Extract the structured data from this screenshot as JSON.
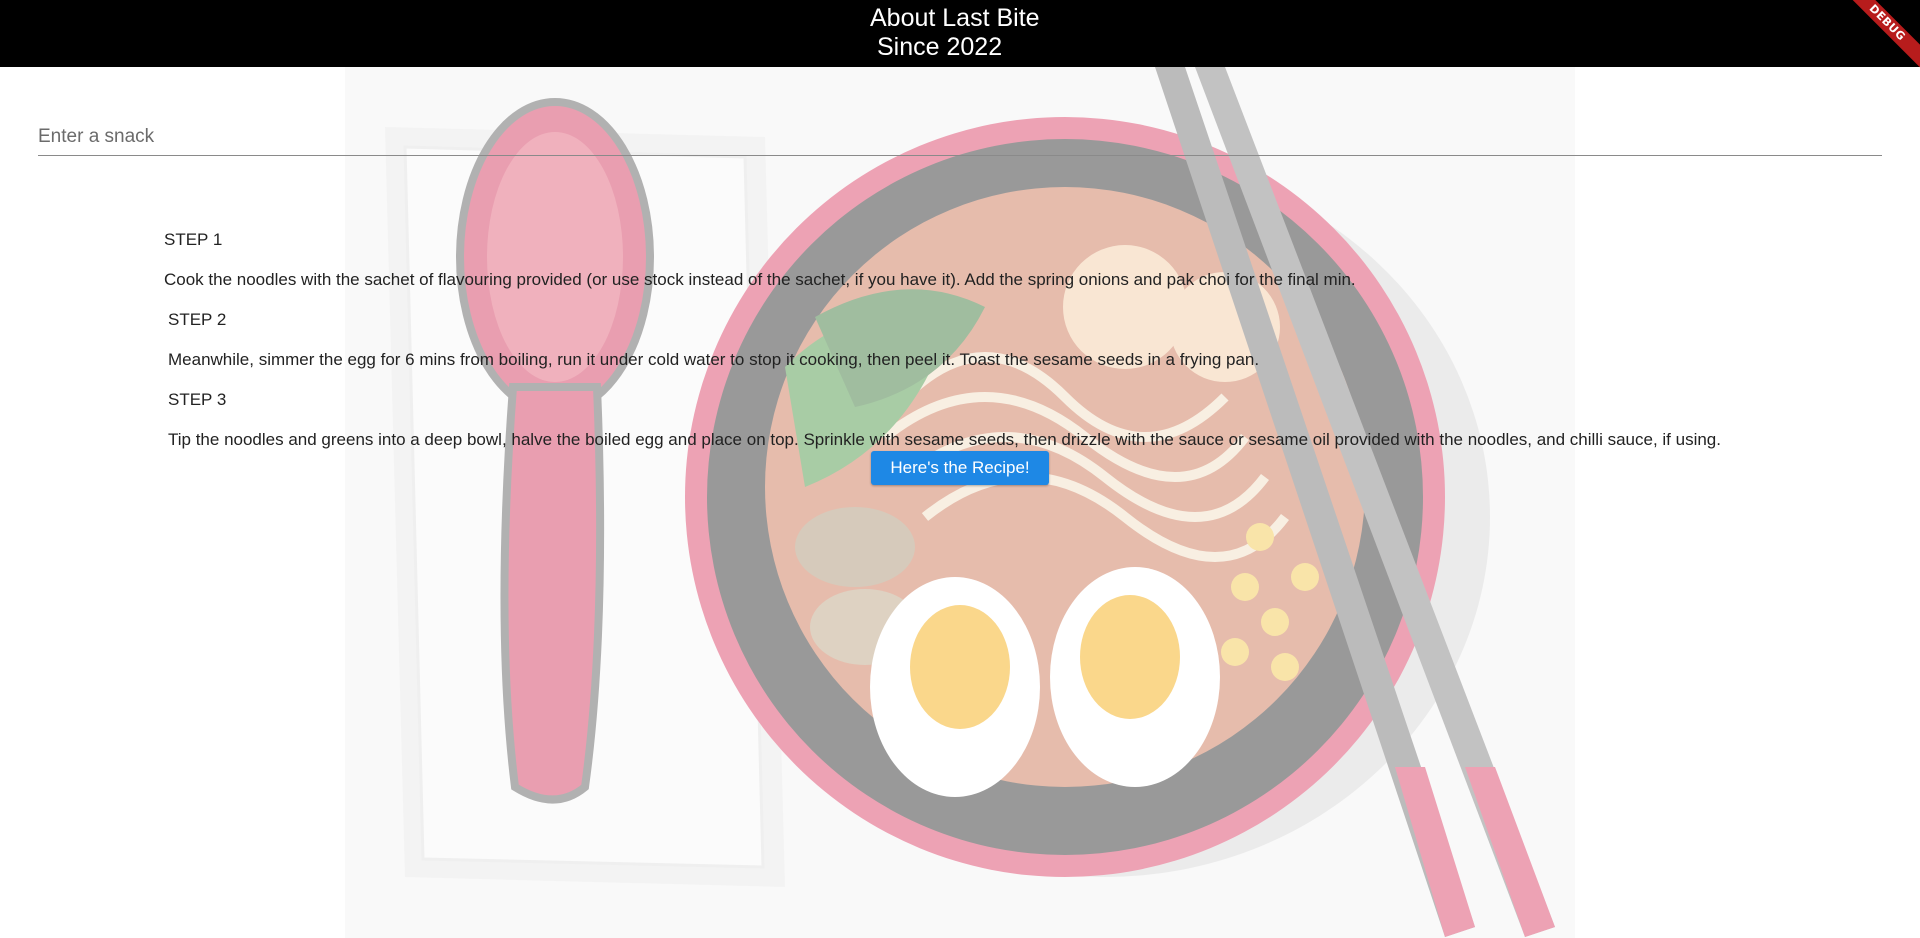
{
  "app_bar": {
    "title": "About Last Bite",
    "subtitle": "Since 2022",
    "debug_label": "DEBUG"
  },
  "search": {
    "placeholder": "Enter a snack",
    "value": ""
  },
  "recipe": {
    "steps": [
      {
        "title": "STEP 1",
        "text": "Cook the noodles with the sachet of flavouring provided (or use stock instead of the sachet, if you have it). Add the spring onions and pak choi for the final min."
      },
      {
        "title": "STEP 2",
        "text": "Meanwhile, simmer the egg for 6 mins from boiling, run it under cold water to stop it cooking, then peel it. Toast the sesame seeds in a frying pan."
      },
      {
        "title": "STEP 3",
        "text": "Tip the noodles and greens into a deep bowl, halve the boiled egg and place on top. Sprinkle with sesame seeds, then drizzle with the sauce or sesame oil provided with the noodles, and chilli sauce, if using."
      }
    ],
    "button_label": "Here's the Recipe!"
  },
  "colors": {
    "app_bar": "#000000",
    "button": "#1e88e5",
    "debug_ribbon": "#b71c1c"
  },
  "background_image": "ramen-bowl-illustration"
}
